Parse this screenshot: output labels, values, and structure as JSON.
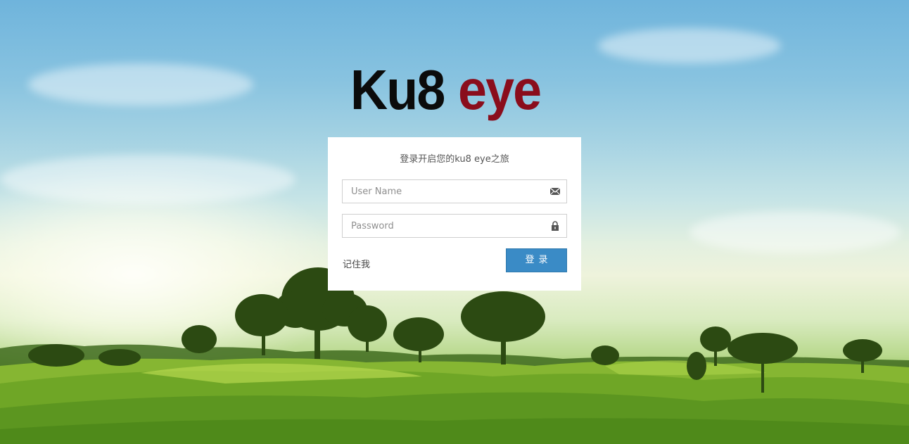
{
  "brand": {
    "part1": "Ku8",
    "part2": "eye",
    "part1_color": "#0b0b0b",
    "part2_color": "#8a0d1c"
  },
  "login": {
    "title": "登录开启您的ku8 eye之旅",
    "username": {
      "placeholder": "User Name",
      "value": "",
      "icon": "envelope-icon"
    },
    "password": {
      "placeholder": "Password",
      "value": "",
      "icon": "lock-icon"
    },
    "remember_label": "记住我",
    "submit_label": "登录",
    "accent_color": "#3a8bc6"
  },
  "background": {
    "description_icon": "landscape-background"
  }
}
